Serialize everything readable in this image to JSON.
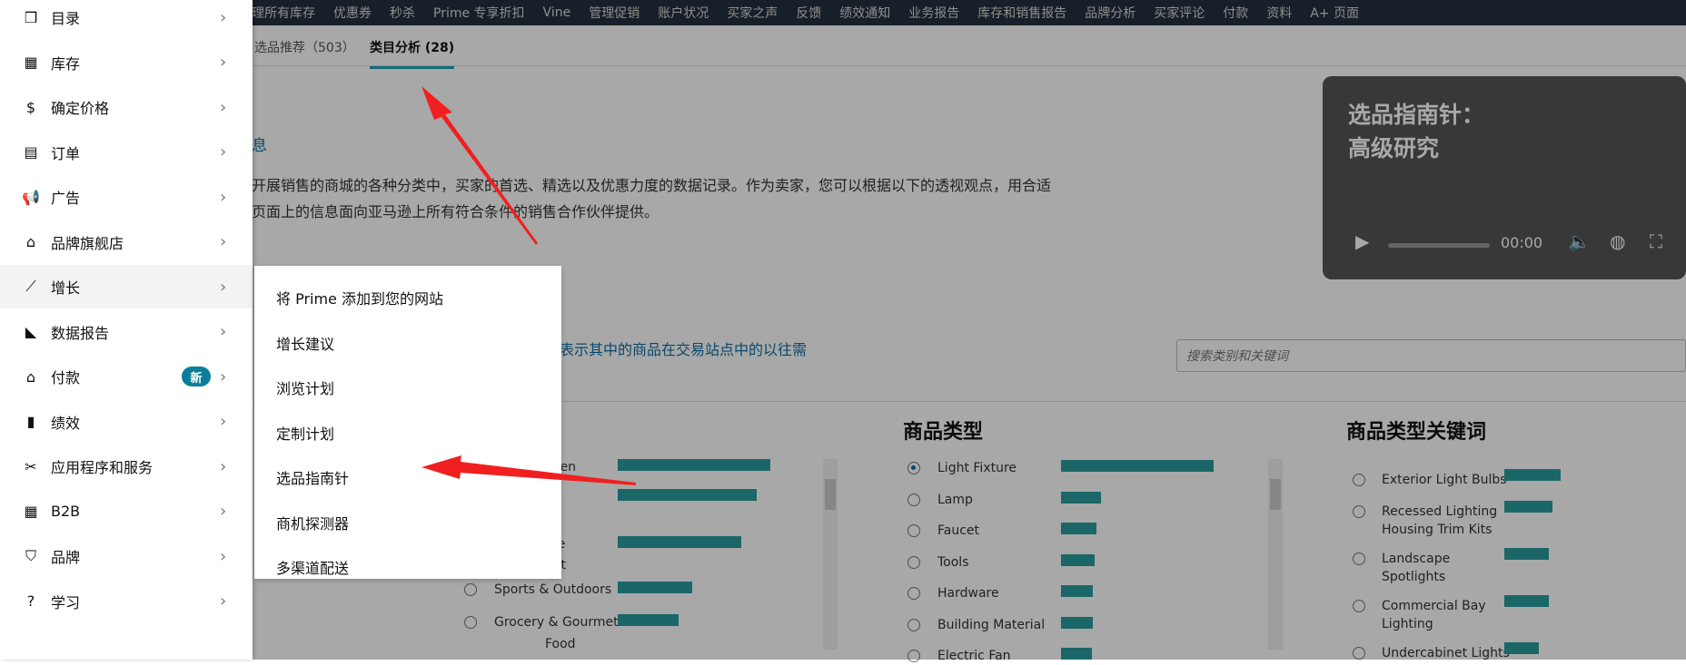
{
  "topnav": {
    "items": [
      "理所有库存",
      "优惠券",
      "秒杀",
      "Prime 专享折扣",
      "Vine",
      "管理促销",
      "账户状况",
      "买家之声",
      "反馈",
      "绩效通知",
      "业务报告",
      "库存和销售报告",
      "品牌分析",
      "买家评论",
      "付款",
      "资料",
      "A+ 页面"
    ]
  },
  "subtabs": {
    "tab1": "选品推荐（503）",
    "tab2": "类目分析 (28)"
  },
  "intro": {
    "title": "息",
    "line1": "开展销售的商城的各种分类中，买家的首选、精选以及优惠力度的数据记录。作为卖家，您可以根据以下的透视观点，用合适",
    "line2": "页面上的信息面向亚马逊上所有符合条件的销售合作伙伴提供。"
  },
  "video": {
    "title_line1": "选品指南针：",
    "title_line2": "高级研究",
    "time": "00:00"
  },
  "filter_hint": "量表示其中的商品在交易站点中的以往需",
  "search": {
    "placeholder": "搜索类别和关键词"
  },
  "columns": {
    "category": {
      "items": [
        {
          "label": "chen",
          "value": 100
        },
        {
          "label": "hoes &",
          "value": 91
        },
        {
          "label": "me",
          "value": 81
        },
        {
          "label": "ent",
          "value": 0
        },
        {
          "label": "Sports & Outdoors",
          "value": 49
        },
        {
          "label": "Grocery & Gourmet",
          "value": 40
        },
        {
          "label": "Food",
          "value": 0
        }
      ]
    },
    "product_type": {
      "title": "商品类型",
      "items": [
        {
          "label": "Light Fixture",
          "value": 100,
          "checked": true
        },
        {
          "label": "Lamp",
          "value": 26
        },
        {
          "label": "Faucet",
          "value": 23
        },
        {
          "label": "Tools",
          "value": 22
        },
        {
          "label": "Hardware",
          "value": 21
        },
        {
          "label": "Building Material",
          "value": 21
        },
        {
          "label": "Electric Fan",
          "value": 20
        }
      ]
    },
    "keywords": {
      "title": "商品类型关键词",
      "items": [
        {
          "label1": "Exterior Light Bulbs",
          "label2": "",
          "value": 100
        },
        {
          "label1": "Recessed Lighting",
          "label2": "Housing Trim Kits",
          "value": 85
        },
        {
          "label1": "Landscape",
          "label2": "Spotlights",
          "value": 79
        },
        {
          "label1": "Commercial Bay",
          "label2": "Lighting",
          "value": 79
        },
        {
          "label1": "Undercabinet Lights",
          "label2": "",
          "value": 62
        }
      ]
    }
  },
  "leftmenu": {
    "items": [
      {
        "label": "目录",
        "icon": "catalog-icon"
      },
      {
        "label": "库存",
        "icon": "inventory-icon"
      },
      {
        "label": "确定价格",
        "icon": "pricing-icon"
      },
      {
        "label": "订单",
        "icon": "orders-icon"
      },
      {
        "label": "广告",
        "icon": "megaphone-icon"
      },
      {
        "label": "品牌旗舰店",
        "icon": "store-icon"
      },
      {
        "label": "增长",
        "icon": "growth-icon"
      },
      {
        "label": "数据报告",
        "icon": "reports-icon"
      },
      {
        "label": "付款",
        "icon": "bank-icon",
        "badge": "新"
      },
      {
        "label": "绩效",
        "icon": "bar-chart-icon"
      },
      {
        "label": "应用程序和服务",
        "icon": "tools-icon"
      },
      {
        "label": "B2B",
        "icon": "building-icon"
      },
      {
        "label": "品牌",
        "icon": "shield-icon"
      },
      {
        "label": "学习",
        "icon": "help-icon"
      }
    ]
  },
  "submenu": {
    "items": [
      "将 Prime 添加到您的网站",
      "增长建议",
      "浏览计划",
      "定制计划",
      "选品指南针",
      "商机探测器",
      "多渠道配送"
    ]
  },
  "colors": {
    "accent": "#2a9d9d",
    "link": "#0b6ea5",
    "arrow": "#f02020"
  }
}
